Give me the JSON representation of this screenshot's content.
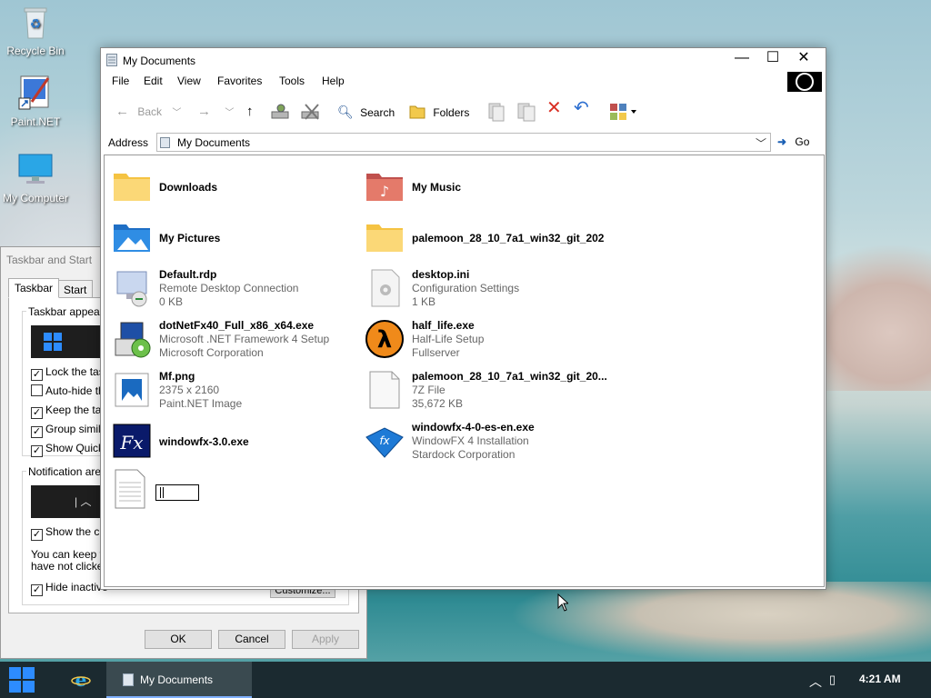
{
  "desktop": {
    "icons": [
      {
        "label": "Recycle Bin"
      },
      {
        "label": "Paint.NET"
      },
      {
        "label": "My Computer"
      }
    ]
  },
  "taskbar_dialog": {
    "title": "Taskbar and Start",
    "tabs": [
      "Taskbar",
      "Start Me"
    ],
    "group_appearance": "Taskbar appeara",
    "checks": [
      {
        "label": "Lock the task",
        "checked": true
      },
      {
        "label": "Auto-hide the",
        "checked": false
      },
      {
        "label": "Keep the tas",
        "checked": true
      },
      {
        "label": "Group similar",
        "checked": true
      },
      {
        "label": "Show Quick",
        "checked": true
      }
    ],
    "group_notification": "Notification area",
    "show_clock": "Show the clo",
    "info_line1": "You can keep th",
    "info_line2": "have not clicked",
    "hide_inactive": "Hide inactive",
    "customize": "Customize...",
    "ok": "OK",
    "cancel": "Cancel",
    "apply": "Apply"
  },
  "window": {
    "title": "My Documents",
    "controls": {
      "minimize": "—",
      "maximize": "☐",
      "close": "✕"
    },
    "menu": [
      "File",
      "Edit",
      "View",
      "Favorites",
      "Tools",
      "Help"
    ],
    "toolbar": {
      "back": "Back",
      "search": "Search",
      "folders": "Folders"
    },
    "address": {
      "label": "Address",
      "value": "My Documents",
      "go": "Go"
    },
    "items": [
      {
        "name": "Downloads",
        "sub1": "",
        "sub2": ""
      },
      {
        "name": "My Music",
        "sub1": "",
        "sub2": ""
      },
      {
        "name": "My Pictures",
        "sub1": "",
        "sub2": ""
      },
      {
        "name": "palemoon_28_10_7a1_win32_git_202",
        "sub1": "",
        "sub2": ""
      },
      {
        "name": "Default.rdp",
        "sub1": "Remote Desktop Connection",
        "sub2": "0 KB"
      },
      {
        "name": "desktop.ini",
        "sub1": "Configuration Settings",
        "sub2": "1 KB"
      },
      {
        "name": "dotNetFx40_Full_x86_x64.exe",
        "sub1": "Microsoft .NET Framework 4 Setup",
        "sub2": "Microsoft Corporation"
      },
      {
        "name": "half_life.exe",
        "sub1": "Half-Life Setup",
        "sub2": "Fullserver"
      },
      {
        "name": "Mf.png",
        "sub1": "2375 x 2160",
        "sub2": "Paint.NET Image"
      },
      {
        "name": "palemoon_28_10_7a1_win32_git_20...",
        "sub1": "7Z File",
        "sub2": "35,672 KB"
      },
      {
        "name": "windowfx-3.0.exe",
        "sub1": "",
        "sub2": ""
      },
      {
        "name": "windowfx-4-0-es-en.exe",
        "sub1": "WindowFX 4 Installation",
        "sub2": "Stardock Corporation"
      }
    ]
  },
  "taskbar": {
    "task_label": "My Documents",
    "clock": "4:21 AM",
    "tray": "^"
  }
}
